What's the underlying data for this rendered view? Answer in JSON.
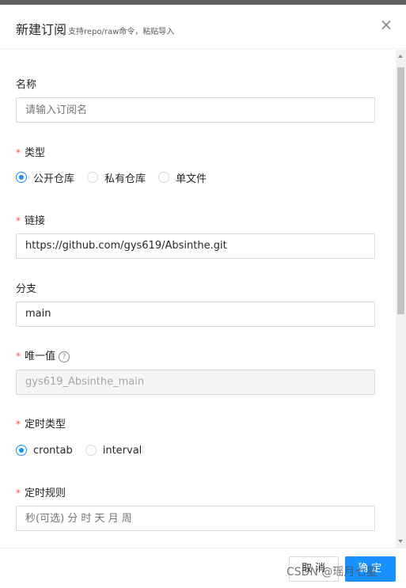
{
  "dialog": {
    "title": "新建订阅",
    "subtitle": "支持repo/raw命令，粘贴导入",
    "close_symbol": "×"
  },
  "form": {
    "name": {
      "label": "名称",
      "placeholder": "请输入订阅名",
      "required": false
    },
    "type": {
      "label": "类型",
      "required": true,
      "options": [
        "公开仓库",
        "私有仓库",
        "单文件"
      ],
      "selected": "公开仓库"
    },
    "link": {
      "label": "链接",
      "value": "https://github.com/gys619/Absinthe.git",
      "required": true
    },
    "branch": {
      "label": "分支",
      "value": "main",
      "required": false
    },
    "unique": {
      "label": "唯一值",
      "value": "gys619_Absinthe_main",
      "required": true,
      "help_icon": "question-circle-icon",
      "help_symbol": "?"
    },
    "schedule_type": {
      "label": "定时类型",
      "required": true,
      "options": [
        "crontab",
        "interval"
      ],
      "selected": "crontab"
    },
    "schedule_rule": {
      "label": "定时规则",
      "placeholder": "秒(可选) 分 时 天 月 周",
      "required": true
    },
    "required_mark": "*"
  },
  "footer": {
    "cancel_label": "取 消",
    "ok_label": "确 定"
  },
  "watermark": "CSDN @瑶月七星",
  "colors": {
    "primary": "#1890ff",
    "required": "#ff4d4f",
    "border": "#d9d9d9"
  }
}
